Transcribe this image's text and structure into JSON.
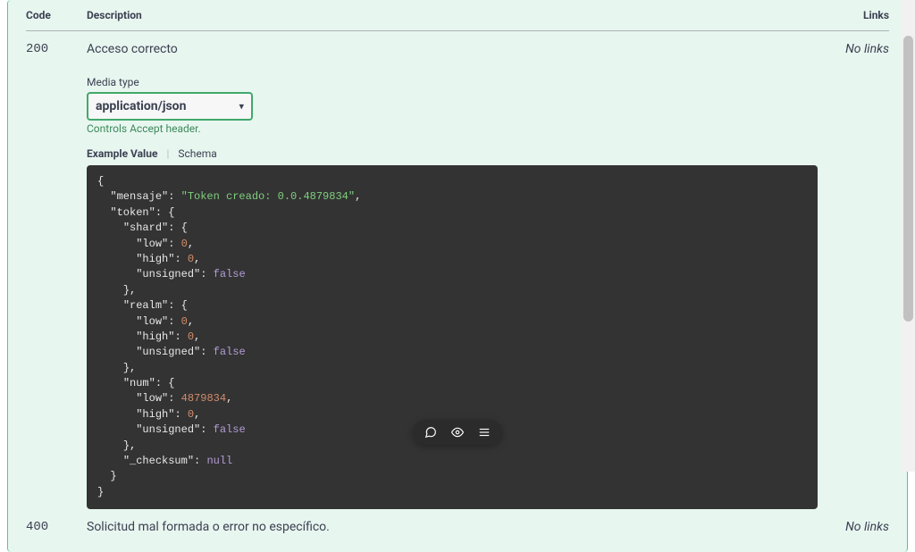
{
  "headers": {
    "code": "Code",
    "description": "Description",
    "links": "Links"
  },
  "responses": [
    {
      "code": "200",
      "description": "Acceso correcto",
      "links": "No links",
      "media_label": "Media type",
      "media_selected": "application/json",
      "controls_hint": "Controls Accept header.",
      "tabs": {
        "example": "Example Value",
        "schema": "Schema"
      },
      "example": {
        "mensaje_key": "\"mensaje\"",
        "mensaje_val": "\"Token creado: 0.0.4879834\"",
        "token_key": "\"token\"",
        "shard_key": "\"shard\"",
        "low_key": "\"low\"",
        "high_key": "\"high\"",
        "unsigned_key": "\"unsigned\"",
        "realm_key": "\"realm\"",
        "num_key": "\"num\"",
        "checksum_key": "\"_checksum\"",
        "zero": "0",
        "numval": "4879834",
        "false_val": "false",
        "null_val": "null"
      }
    },
    {
      "code": "400",
      "description": "Solicitud mal formada o error no específico.",
      "links": "No links"
    }
  ]
}
